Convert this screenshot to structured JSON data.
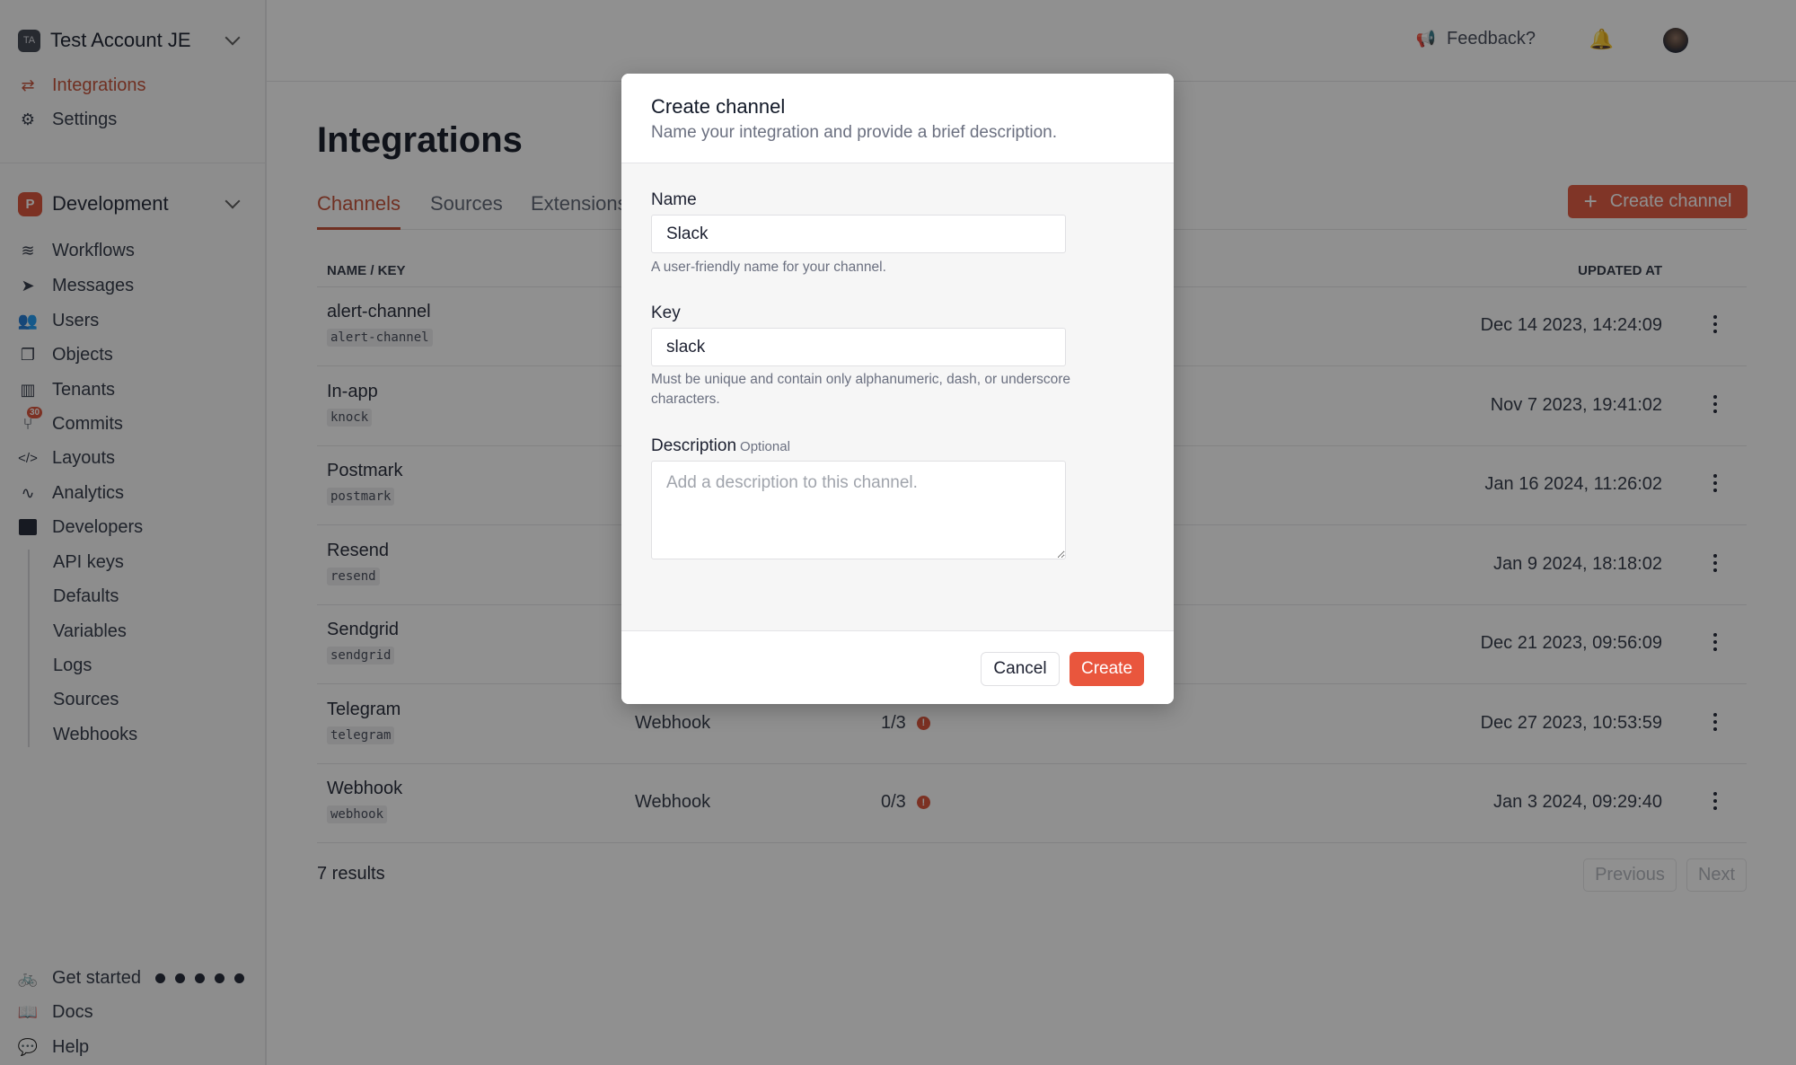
{
  "sidebar": {
    "account": {
      "initials": "TA",
      "name": "Test Account JE"
    },
    "top_items": [
      {
        "label": "Integrations",
        "icon": "arrows-exchange-icon",
        "active": true
      },
      {
        "label": "Settings",
        "icon": "gear-icon",
        "active": false
      }
    ],
    "environment": {
      "initial": "P",
      "name": "Development"
    },
    "items": [
      {
        "label": "Workflows",
        "icon": "layers-icon"
      },
      {
        "label": "Messages",
        "icon": "paper-plane-icon"
      },
      {
        "label": "Users",
        "icon": "users-icon"
      },
      {
        "label": "Objects",
        "icon": "objects-icon"
      },
      {
        "label": "Tenants",
        "icon": "building-icon"
      },
      {
        "label": "Commits",
        "icon": "git-commit-icon",
        "badge": "30"
      },
      {
        "label": "Layouts",
        "icon": "code-icon"
      },
      {
        "label": "Analytics",
        "icon": "pulse-icon"
      },
      {
        "label": "Developers",
        "icon": "terminal-icon"
      }
    ],
    "developer_subitems": [
      "API keys",
      "Defaults",
      "Variables",
      "Logs",
      "Sources",
      "Webhooks"
    ],
    "bottom_items": [
      {
        "label": "Get started",
        "icon": "bicycle-icon",
        "progress_steps": 5
      },
      {
        "label": "Docs",
        "icon": "book-icon"
      },
      {
        "label": "Help",
        "icon": "chat-icon"
      }
    ]
  },
  "topbar": {
    "feedback_label": "Feedback?"
  },
  "page": {
    "title": "Integrations",
    "tabs": [
      "Channels",
      "Sources",
      "Extensions"
    ],
    "active_tab": "Channels",
    "create_button": "Create channel",
    "table": {
      "headers": {
        "name_key": "NAME / KEY",
        "updated_at": "UPDATED AT"
      },
      "rows": [
        {
          "name": "alert-channel",
          "key": "alert-channel",
          "type": "",
          "count": "",
          "updated": "Dec 14 2023, 14:24:09"
        },
        {
          "name": "In-app",
          "key": "knock",
          "type": "",
          "count": "",
          "updated": "Nov 7 2023, 19:41:02"
        },
        {
          "name": "Postmark",
          "key": "postmark",
          "type": "",
          "count": "",
          "updated": "Jan 16 2024, 11:26:02"
        },
        {
          "name": "Resend",
          "key": "resend",
          "type": "",
          "count": "",
          "updated": "Jan 9 2024, 18:18:02"
        },
        {
          "name": "Sendgrid",
          "key": "sendgrid",
          "type": "",
          "count": "",
          "updated": "Dec 21 2023, 09:56:09"
        },
        {
          "name": "Telegram",
          "key": "telegram",
          "type": "Webhook",
          "count": "1/3",
          "warning": true,
          "updated": "Dec 27 2023, 10:53:59"
        },
        {
          "name": "Webhook",
          "key": "webhook",
          "type": "Webhook",
          "count": "0/3",
          "warning": true,
          "updated": "Jan 3 2024, 09:29:40"
        }
      ]
    },
    "results_label": "7 results",
    "pagination": {
      "previous": "Previous",
      "next": "Next"
    }
  },
  "modal": {
    "title": "Create channel",
    "subtitle": "Name your integration and provide a brief description.",
    "name_label": "Name",
    "name_value": "Slack",
    "name_hint": "A user-friendly name for your channel.",
    "key_label": "Key",
    "key_value": "slack",
    "key_hint": "Must be unique and contain only alphanumeric, dash, or underscore characters.",
    "description_label": "Description",
    "description_optional": "Optional",
    "description_placeholder": "Add a description to this channel.",
    "cancel_label": "Cancel",
    "create_label": "Create"
  },
  "colors": {
    "accent": "#e0533a",
    "active_nav": "#c24a30",
    "overlay": "rgba(20,20,20,0.47)"
  }
}
